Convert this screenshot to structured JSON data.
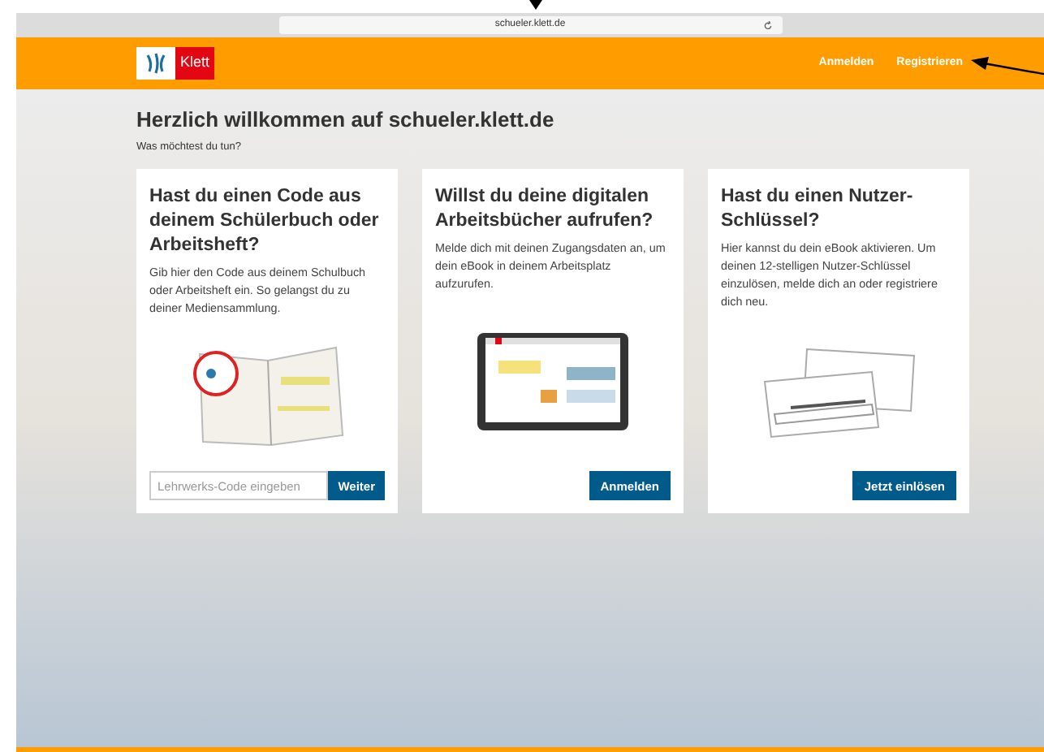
{
  "browser": {
    "url": "schueler.klett.de"
  },
  "header": {
    "logo": "Klett",
    "nav": [
      {
        "label": "Anmelden"
      },
      {
        "label": "Registrieren"
      }
    ]
  },
  "welcome": {
    "title": "Herzlich willkommen auf schueler.klett.de",
    "subtitle": "Was möchtest du tun?"
  },
  "cards": [
    {
      "kind": "code",
      "title": "Hast du einen Code aus deinem Schülerbuch oder Arbeitsheft?",
      "text": "Gib hier den Code aus deinem Schulbuch oder Arbeitsheft ein. So gelangst du zu deiner Mediensammlung.",
      "placeholder": "Lehrwerks-Code eingeben",
      "button": "Weiter"
    },
    {
      "kind": "tablet",
      "title": "Willst du deine digitalen Arbeitsbücher aufrufen?",
      "text": "Melde dich mit deinen Zugangsdaten an, um dein eBook in deinem Arbeitsplatz aufzurufen.",
      "button": "Anmelden"
    },
    {
      "kind": "key",
      "title": "Hast du einen Nutzer-Schlüssel?",
      "text": "Hier kannst du dein eBook aktivieren. Um deinen 12-stelligen Nutzer-Schlüssel einzulösen, melde dich an oder registriere dich neu.",
      "button": "Jetzt einlösen"
    }
  ]
}
